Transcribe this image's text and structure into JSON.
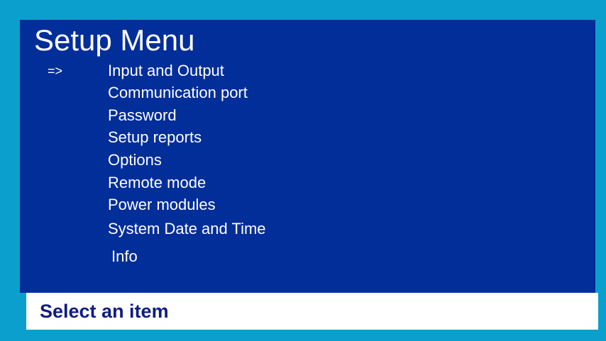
{
  "title": "Setup Menu",
  "cursor": "=>",
  "menu": {
    "items": [
      {
        "label": "Input and Output"
      },
      {
        "label": "Communication port"
      },
      {
        "label": "Password"
      },
      {
        "label": "Setup reports"
      },
      {
        "label": "Options"
      },
      {
        "label": "Remote mode"
      },
      {
        "label": "Power modules"
      },
      {
        "label": "System Date and Time"
      },
      {
        "label": "Info"
      }
    ],
    "selected_index": 0
  },
  "status": {
    "text": "Select an item"
  },
  "colors": {
    "frame": "#0a9fcc",
    "screen_background": "#022e9a",
    "text": "#ffffff",
    "statusbar_background": "#ffffff",
    "status_text": "#0f1d80"
  }
}
